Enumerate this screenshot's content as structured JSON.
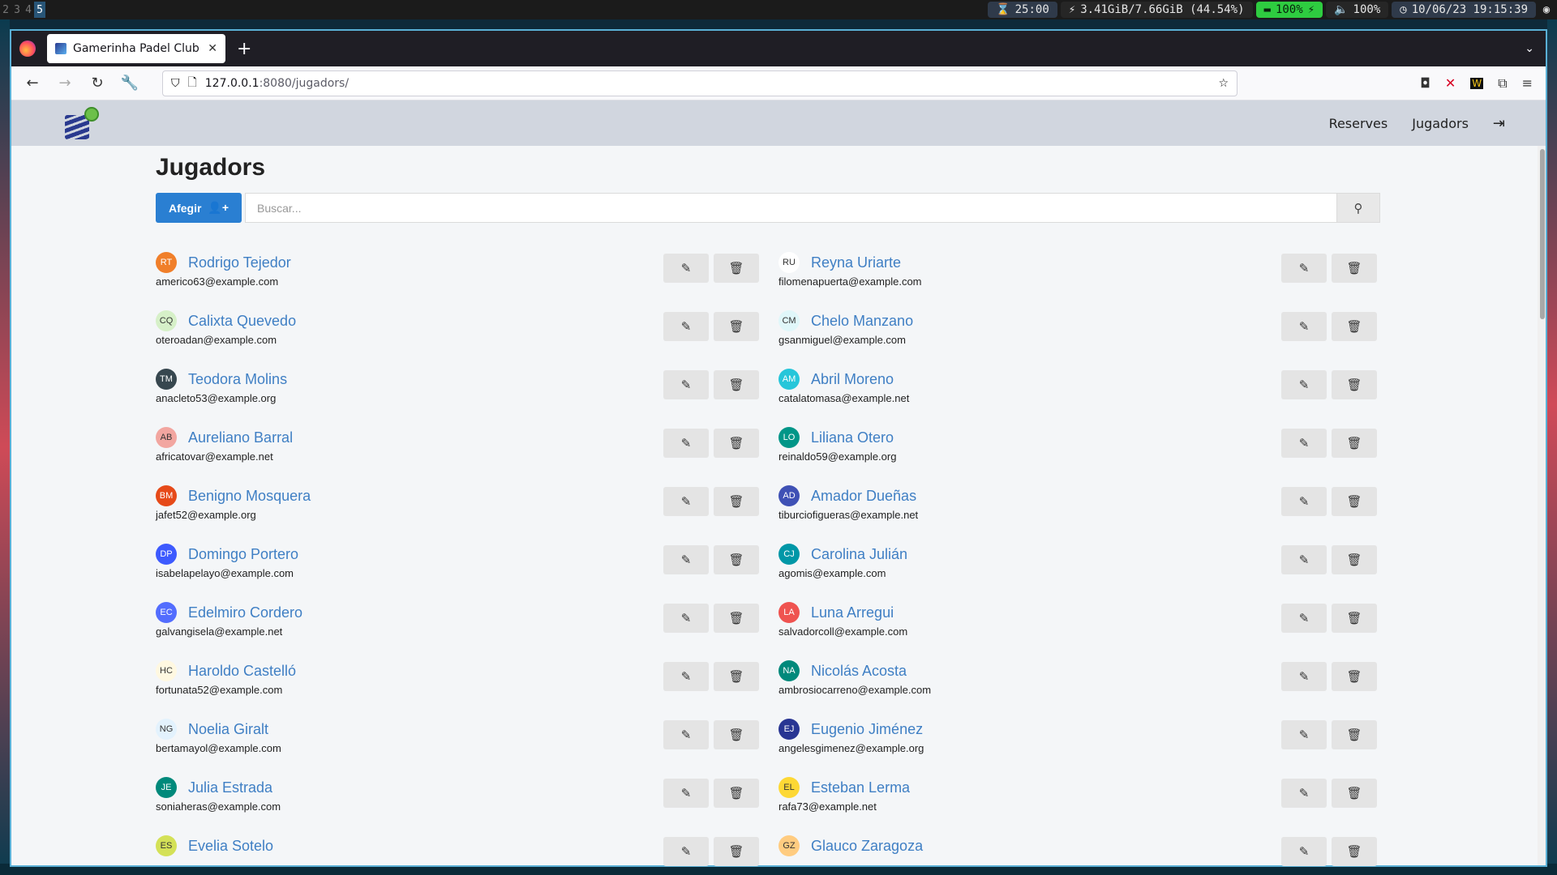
{
  "system_bar": {
    "workspaces": [
      "2",
      "3",
      "4",
      "5"
    ],
    "active_workspace": "5",
    "timer": "25:00",
    "memory": "3.41GiB/7.66GiB (44.54%)",
    "battery": "100%",
    "volume": "100%",
    "datetime": "10/06/23 19:15:39"
  },
  "browser": {
    "tab_title": "Gamerinha Padel Club",
    "url_host": "127.0.0.1",
    "url_rest": ":8080/jugadors/"
  },
  "site": {
    "nav": {
      "reserves": "Reserves",
      "jugadors": "Jugadors"
    }
  },
  "page": {
    "title": "Jugadors",
    "add_label": "Afegir",
    "search_placeholder": "Buscar..."
  },
  "players": {
    "left": [
      {
        "initials": "RT",
        "name": "Rodrigo Tejedor",
        "email": "americo63@example.com",
        "color": "#f07f2a"
      },
      {
        "initials": "CQ",
        "name": "Calixta Quevedo",
        "email": "oteroadan@example.com",
        "color": "#d6f0c8"
      },
      {
        "initials": "TM",
        "name": "Teodora Molins",
        "email": "anacleto53@example.org",
        "color": "#37474f"
      },
      {
        "initials": "AB",
        "name": "Aureliano Barral",
        "email": "africatovar@example.net",
        "color": "#f2a6a0"
      },
      {
        "initials": "BM",
        "name": "Benigno Mosquera",
        "email": "jafet52@example.org",
        "color": "#e64a19"
      },
      {
        "initials": "DP",
        "name": "Domingo Portero",
        "email": "isabelapelayo@example.com",
        "color": "#3d5afe"
      },
      {
        "initials": "EC",
        "name": "Edelmiro Cordero",
        "email": "galvangisela@example.net",
        "color": "#536dfe"
      },
      {
        "initials": "HC",
        "name": "Haroldo Castelló",
        "email": "fortunata52@example.com",
        "color": "#fff8e1"
      },
      {
        "initials": "NG",
        "name": "Noelia Giralt",
        "email": "bertamayol@example.com",
        "color": "#e3f2fd"
      },
      {
        "initials": "JE",
        "name": "Julia Estrada",
        "email": "soniaheras@example.com",
        "color": "#00897b"
      },
      {
        "initials": "ES",
        "name": "Evelia Sotelo",
        "email": "",
        "color": "#d4e157"
      }
    ],
    "right": [
      {
        "initials": "RU",
        "name": "Reyna Uriarte",
        "email": "filomenapuerta@example.com",
        "color": "#ffffff"
      },
      {
        "initials": "CM",
        "name": "Chelo Manzano",
        "email": "gsanmiguel@example.com",
        "color": "#e0f7fa"
      },
      {
        "initials": "AM",
        "name": "Abril Moreno",
        "email": "catalatomasa@example.net",
        "color": "#26c6da"
      },
      {
        "initials": "LO",
        "name": "Liliana Otero",
        "email": "reinaldo59@example.org",
        "color": "#009688"
      },
      {
        "initials": "AD",
        "name": "Amador Dueñas",
        "email": "tiburciofigueras@example.net",
        "color": "#3f51b5"
      },
      {
        "initials": "CJ",
        "name": "Carolina Julián",
        "email": "agomis@example.com",
        "color": "#0097a7"
      },
      {
        "initials": "LA",
        "name": "Luna Arregui",
        "email": "salvadorcoll@example.com",
        "color": "#ef5350"
      },
      {
        "initials": "NA",
        "name": "Nicolás Acosta",
        "email": "ambrosiocarreno@example.com",
        "color": "#00897b"
      },
      {
        "initials": "EJ",
        "name": "Eugenio Jiménez",
        "email": "angelesgimenez@example.org",
        "color": "#283593"
      },
      {
        "initials": "EL",
        "name": "Esteban Lerma",
        "email": "rafa73@example.net",
        "color": "#fdd835"
      },
      {
        "initials": "GZ",
        "name": "Glauco Zaragoza",
        "email": "",
        "color": "#ffcc80"
      }
    ]
  }
}
